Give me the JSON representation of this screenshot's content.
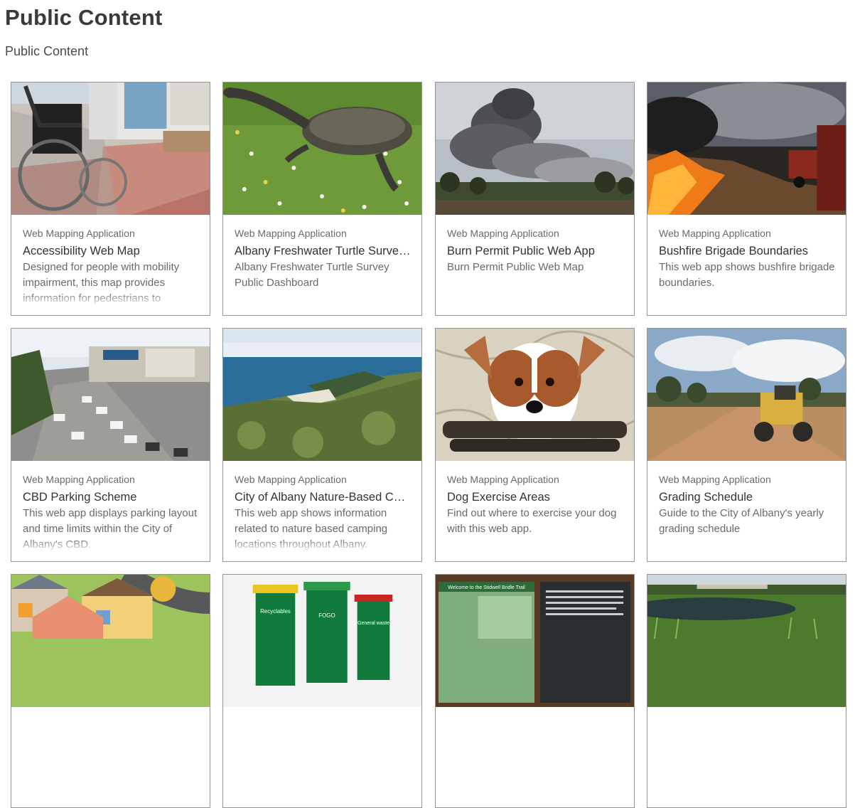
{
  "header": {
    "title": "Public Content",
    "subtitle": "Public Content"
  },
  "cards": [
    {
      "type": "Web Mapping Application",
      "title": "Accessibility Web Map",
      "description": "Designed for people with mobility impairment, this map provides information for pedestrians to",
      "thumbnail": "wheelchair-ramp"
    },
    {
      "type": "Web Mapping Application",
      "title": "Albany Freshwater Turtle Survey Dashboard",
      "description": "Albany Freshwater Turtle Survey Public Dashboard",
      "thumbnail": "turtle-on-grass"
    },
    {
      "type": "Web Mapping Application",
      "title": "Burn Permit Public Web App",
      "description": "Burn Permit Public Web Map",
      "thumbnail": "smoke-plume"
    },
    {
      "type": "Web Mapping Application",
      "title": "Bushfire Brigade Boundaries",
      "description": "This web app shows bushfire brigade boundaries.",
      "thumbnail": "bushfire-truck"
    },
    {
      "type": "Web Mapping Application",
      "title": "CBD Parking Scheme",
      "description": "This web app displays parking layout and time limits within the City of Albany's CBD.",
      "thumbnail": "street-parking"
    },
    {
      "type": "Web Mapping Application",
      "title": "City of Albany Nature-Based Camping",
      "description": "This web app shows information related to nature based camping locations throughout Albany.",
      "thumbnail": "coastline"
    },
    {
      "type": "Web Mapping Application",
      "title": "Dog Exercise Areas",
      "description": "Find out where to exercise your dog with this web app.",
      "thumbnail": "dog-with-leash"
    },
    {
      "type": "Web Mapping Application",
      "title": "Grading Schedule",
      "description": "Guide to the City of Albany's yearly grading schedule",
      "thumbnail": "road-grader"
    },
    {
      "type": "",
      "title": "",
      "description": "",
      "thumbnail": "houses-illustration"
    },
    {
      "type": "",
      "title": "",
      "description": "",
      "thumbnail": "waste-bins"
    },
    {
      "type": "",
      "title": "",
      "description": "",
      "thumbnail": "trail-signboard"
    },
    {
      "type": "",
      "title": "",
      "description": "",
      "thumbnail": "wetland"
    }
  ],
  "bins": {
    "recyclables": "Recyclables",
    "fogo": "FOGO",
    "general": "General waste"
  },
  "signboard": {
    "heading": "Welcome to the Stidwell Bridle Trail"
  }
}
